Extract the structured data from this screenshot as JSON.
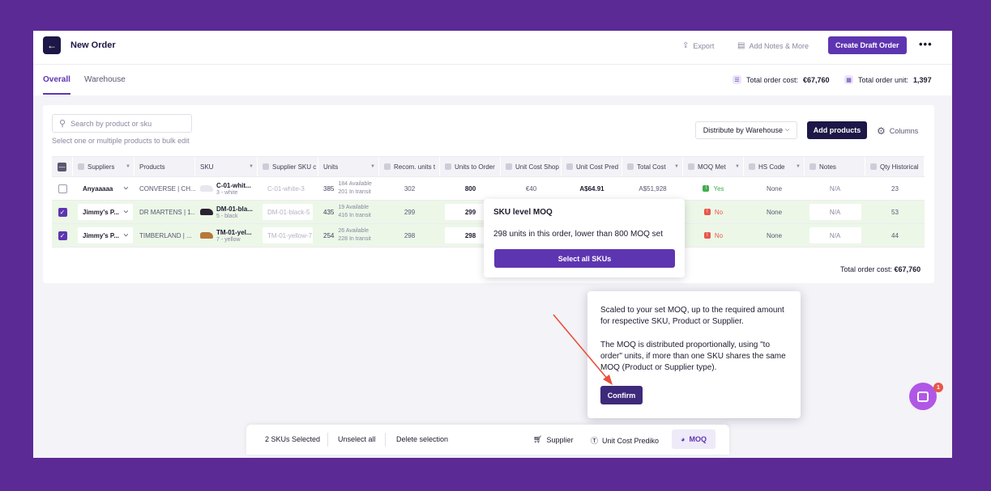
{
  "header": {
    "back_icon": "arrow-left-icon",
    "title": "New Order",
    "export_label": "Export",
    "add_notes_label": "Add Notes & More",
    "create_draft_label": "Create Draft Order",
    "more_label": "•••"
  },
  "tabs": [
    {
      "label": "Overall",
      "active": true
    },
    {
      "label": "Warehouse",
      "active": false
    }
  ],
  "summary": {
    "total_cost_label": "Total order cost:",
    "total_cost_value": "€67,760",
    "total_unit_label": "Total order unit:",
    "total_unit_value": "1,397"
  },
  "toolbar": {
    "search_placeholder": "Search by product or sku",
    "hint": "Select one or multiple products to bulk edit",
    "distribute_label": "Distribute by Warehouse",
    "add_products_label": "Add products",
    "columns_label": "Columns"
  },
  "table": {
    "columns": [
      "Suppliers",
      "Products",
      "SKU",
      "Supplier SKU c",
      "Units",
      "Recom. units t",
      "Units to Order",
      "Unit Cost Shop",
      "Unit Cost Pred",
      "Total Cost",
      "MOQ Met",
      "HS Code",
      "Notes",
      "Qty Historical"
    ],
    "rows": [
      {
        "selected": false,
        "supplier": "Anyaaaaa",
        "product": "CONVERSE | CH...",
        "sku": "C-01-whit...",
        "sku_sub": "3 - white",
        "shoe_color": "#e9e6ee",
        "supplier_sku": "C-01-white-3",
        "units": "385",
        "available": "184 Available",
        "transit": "201 In transit",
        "recom": "302",
        "to_order": "800",
        "cost_shop": "€40",
        "cost_pred": "A$64.91",
        "total": "A$51,928",
        "moq": "Yes",
        "hs": "None",
        "notes": "N/A",
        "qty_hist": "23"
      },
      {
        "selected": true,
        "supplier": "Jimmy's P...",
        "product": "DR MARTENS | 1...",
        "sku": "DM-01-bla...",
        "sku_sub": "5 - black",
        "shoe_color": "#2b2230",
        "supplier_sku": "DM-01-black-5",
        "units": "435",
        "available": "19 Available",
        "transit": "416 In transit",
        "recom": "299",
        "to_order": "299",
        "cost_shop": "",
        "cost_pred": "",
        "total": "",
        "moq": "No",
        "hs": "None",
        "notes": "N/A",
        "qty_hist": "53"
      },
      {
        "selected": true,
        "supplier": "Jimmy's P...",
        "product": "TIMBERLAND | ...",
        "sku": "TM-01-yel...",
        "sku_sub": "7 - yellow",
        "shoe_color": "#b7783a",
        "supplier_sku": "TM-01-yellow-7",
        "units": "254",
        "available": "26 Available",
        "transit": "228 In transit",
        "recom": "298",
        "to_order": "298",
        "cost_shop": "",
        "cost_pred": "",
        "total": "",
        "moq": "No",
        "hs": "None",
        "notes": "N/A",
        "qty_hist": "44"
      }
    ],
    "footer_label": "Total order cost:",
    "footer_value": "€67,760"
  },
  "popover": {
    "title": "SKU level MOQ",
    "description": "298 units in this order, lower than 800 MOQ set",
    "button_label": "Select all SKUs"
  },
  "tooltip": {
    "paragraph1": "Scaled to your set MOQ, up to the required amount for respective SKU, Product or Supplier.",
    "paragraph2": "The MOQ is distributed proportionally, using \"to order\" units, if more than one SKU shares the same MOQ (Product or Supplier type).",
    "confirm_label": "Confirm"
  },
  "bottom_bar": {
    "selected_label": "2 SKUs Selected",
    "unselect_label": "Unselect all",
    "delete_label": "Delete selection",
    "supplier_label": "Supplier",
    "unit_cost_label": "Unit Cost Prediko",
    "moq_label": "MOQ"
  },
  "chat": {
    "badge": "1"
  },
  "colors": {
    "accent": "#5e35b1",
    "dark": "#1c1746",
    "success": "#3fae4f",
    "danger": "#e8574b",
    "backdrop": "#5b2a95"
  }
}
